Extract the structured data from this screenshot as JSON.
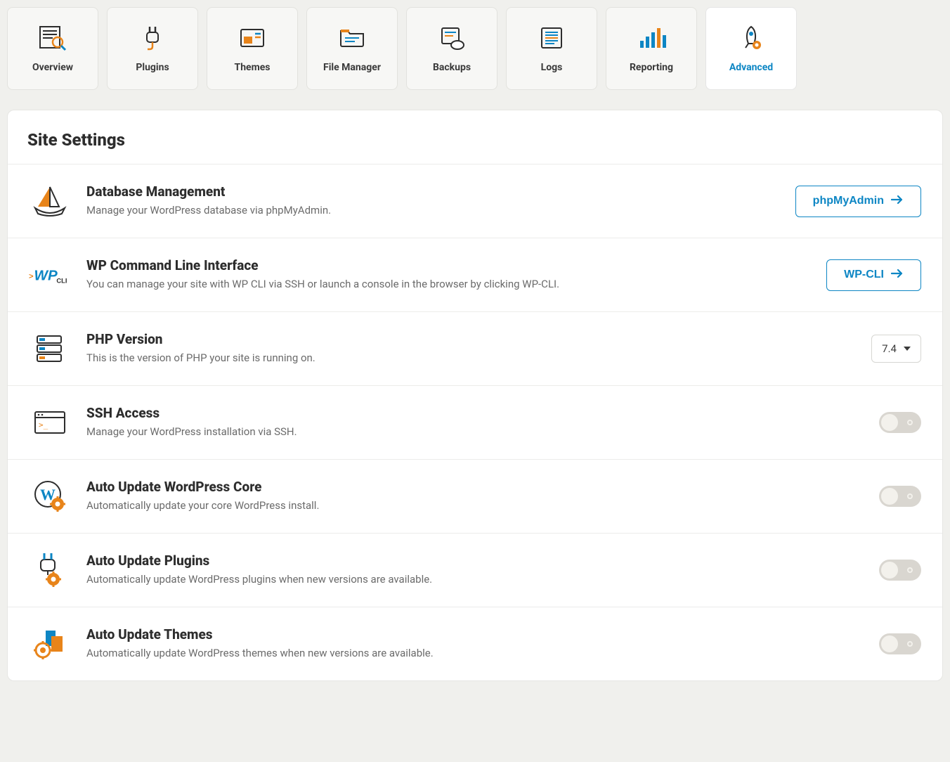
{
  "tabs": [
    {
      "label": "Overview"
    },
    {
      "label": "Plugins"
    },
    {
      "label": "Themes"
    },
    {
      "label": "File Manager"
    },
    {
      "label": "Backups"
    },
    {
      "label": "Logs"
    },
    {
      "label": "Reporting"
    },
    {
      "label": "Advanced"
    }
  ],
  "panel_title": "Site Settings",
  "rows": {
    "db": {
      "title": "Database Management",
      "desc": "Manage your WordPress database via phpMyAdmin.",
      "button": "phpMyAdmin"
    },
    "wpcli": {
      "title": "WP Command Line Interface",
      "desc": "You can manage your site with WP CLI via SSH or launch a console in the browser by clicking WP-CLI.",
      "button": "WP-CLI"
    },
    "php": {
      "title": "PHP Version",
      "desc": "This is the version of PHP your site is running on.",
      "value": "7.4"
    },
    "ssh": {
      "title": "SSH Access",
      "desc": "Manage your WordPress installation via SSH."
    },
    "core": {
      "title": "Auto Update WordPress Core",
      "desc": "Automatically update your core WordPress install."
    },
    "plugins": {
      "title": "Auto Update Plugins",
      "desc": "Automatically update WordPress plugins when new versions are available."
    },
    "themes": {
      "title": "Auto Update Themes",
      "desc": "Automatically update WordPress themes when new versions are available."
    }
  }
}
